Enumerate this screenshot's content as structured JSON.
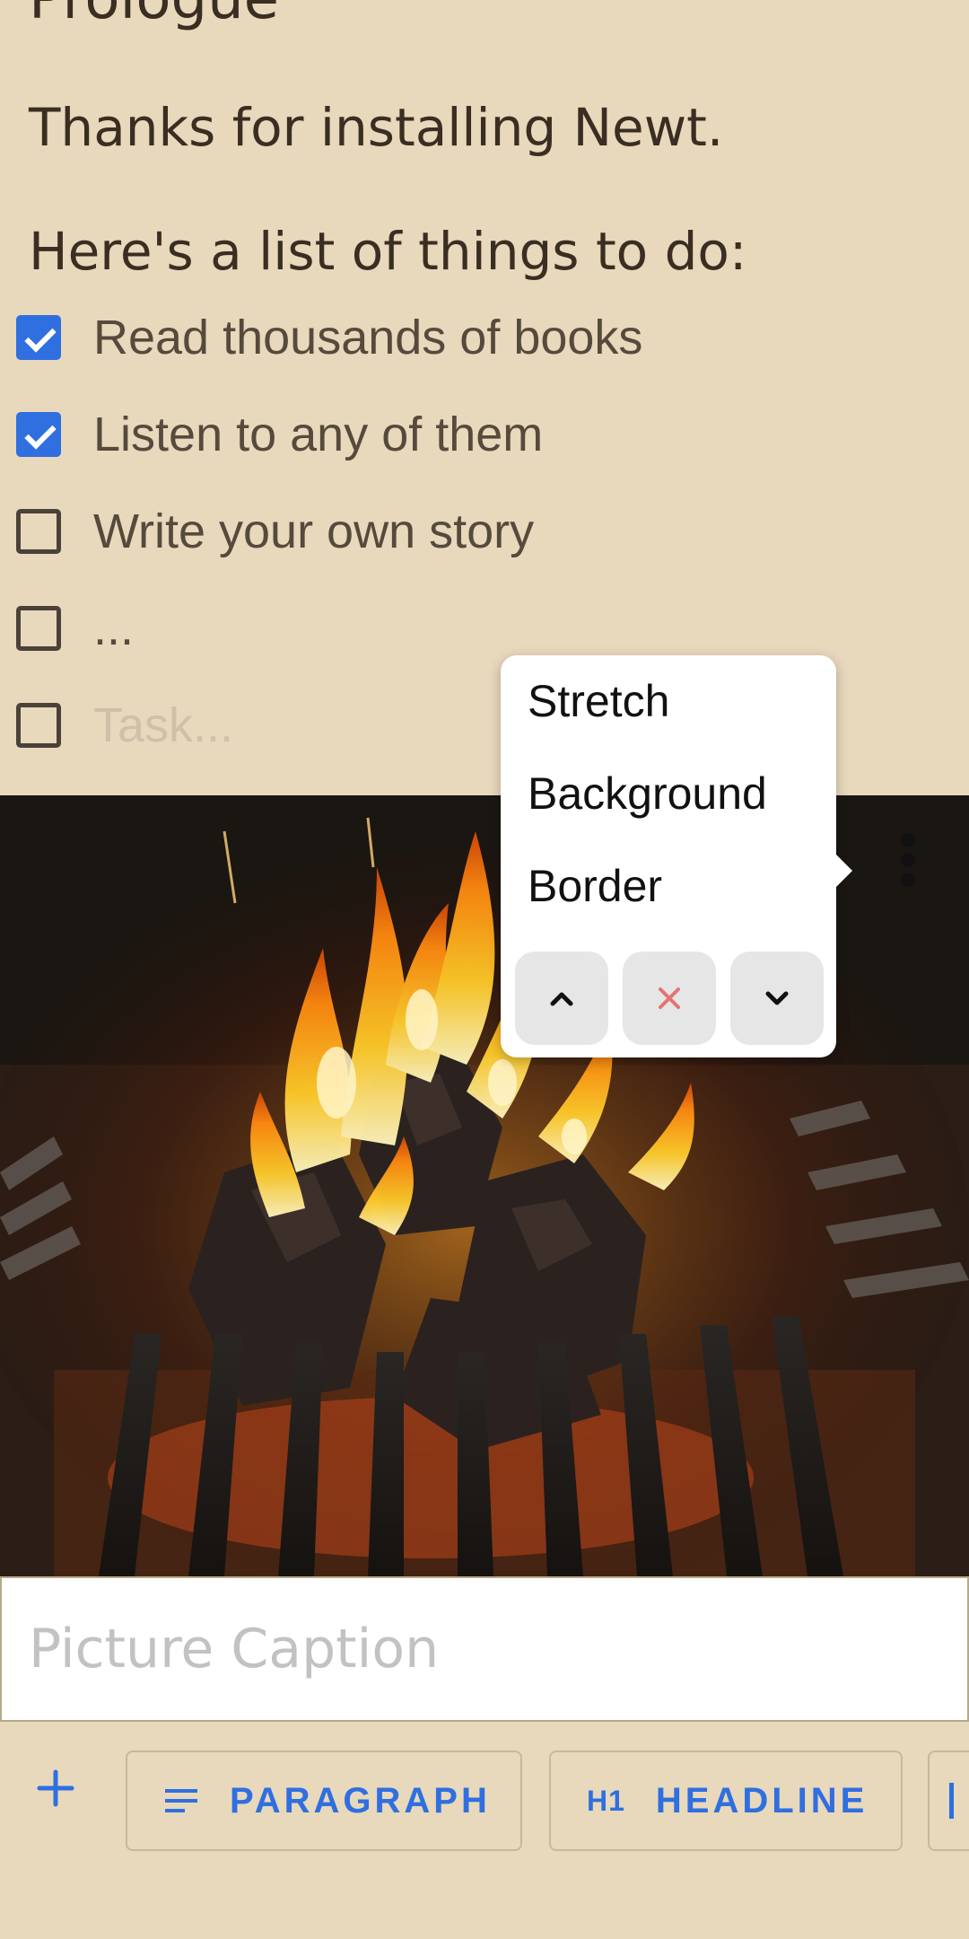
{
  "document": {
    "title": "Prologue",
    "paragraphs": [
      "Thanks for installing Newt.",
      "Here's a list of things to do:"
    ],
    "tasks": [
      {
        "text": "Read thousands of books",
        "checked": true
      },
      {
        "text": "Listen to any of them",
        "checked": true
      },
      {
        "text": "Write your own story",
        "checked": false
      },
      {
        "text": "...",
        "checked": false
      }
    ],
    "new_task_placeholder": "Task..."
  },
  "image_menu": {
    "items": [
      "Stretch",
      "Background",
      "Border"
    ],
    "buttons": {
      "up_icon": "chevron-up-icon",
      "remove_icon": "close-icon",
      "down_icon": "chevron-down-icon"
    }
  },
  "picture": {
    "caption_placeholder": "Picture Caption",
    "subject": "fireplace-fire"
  },
  "toolbar": {
    "add_icon": "plus-icon",
    "paragraph_label": "PARAGRAPH",
    "headline_label": "HEADLINE",
    "headline_icon_text": "H1"
  },
  "colors": {
    "background": "#e8d8bc",
    "accent": "#2f6fe0",
    "remove": "#e57373"
  }
}
